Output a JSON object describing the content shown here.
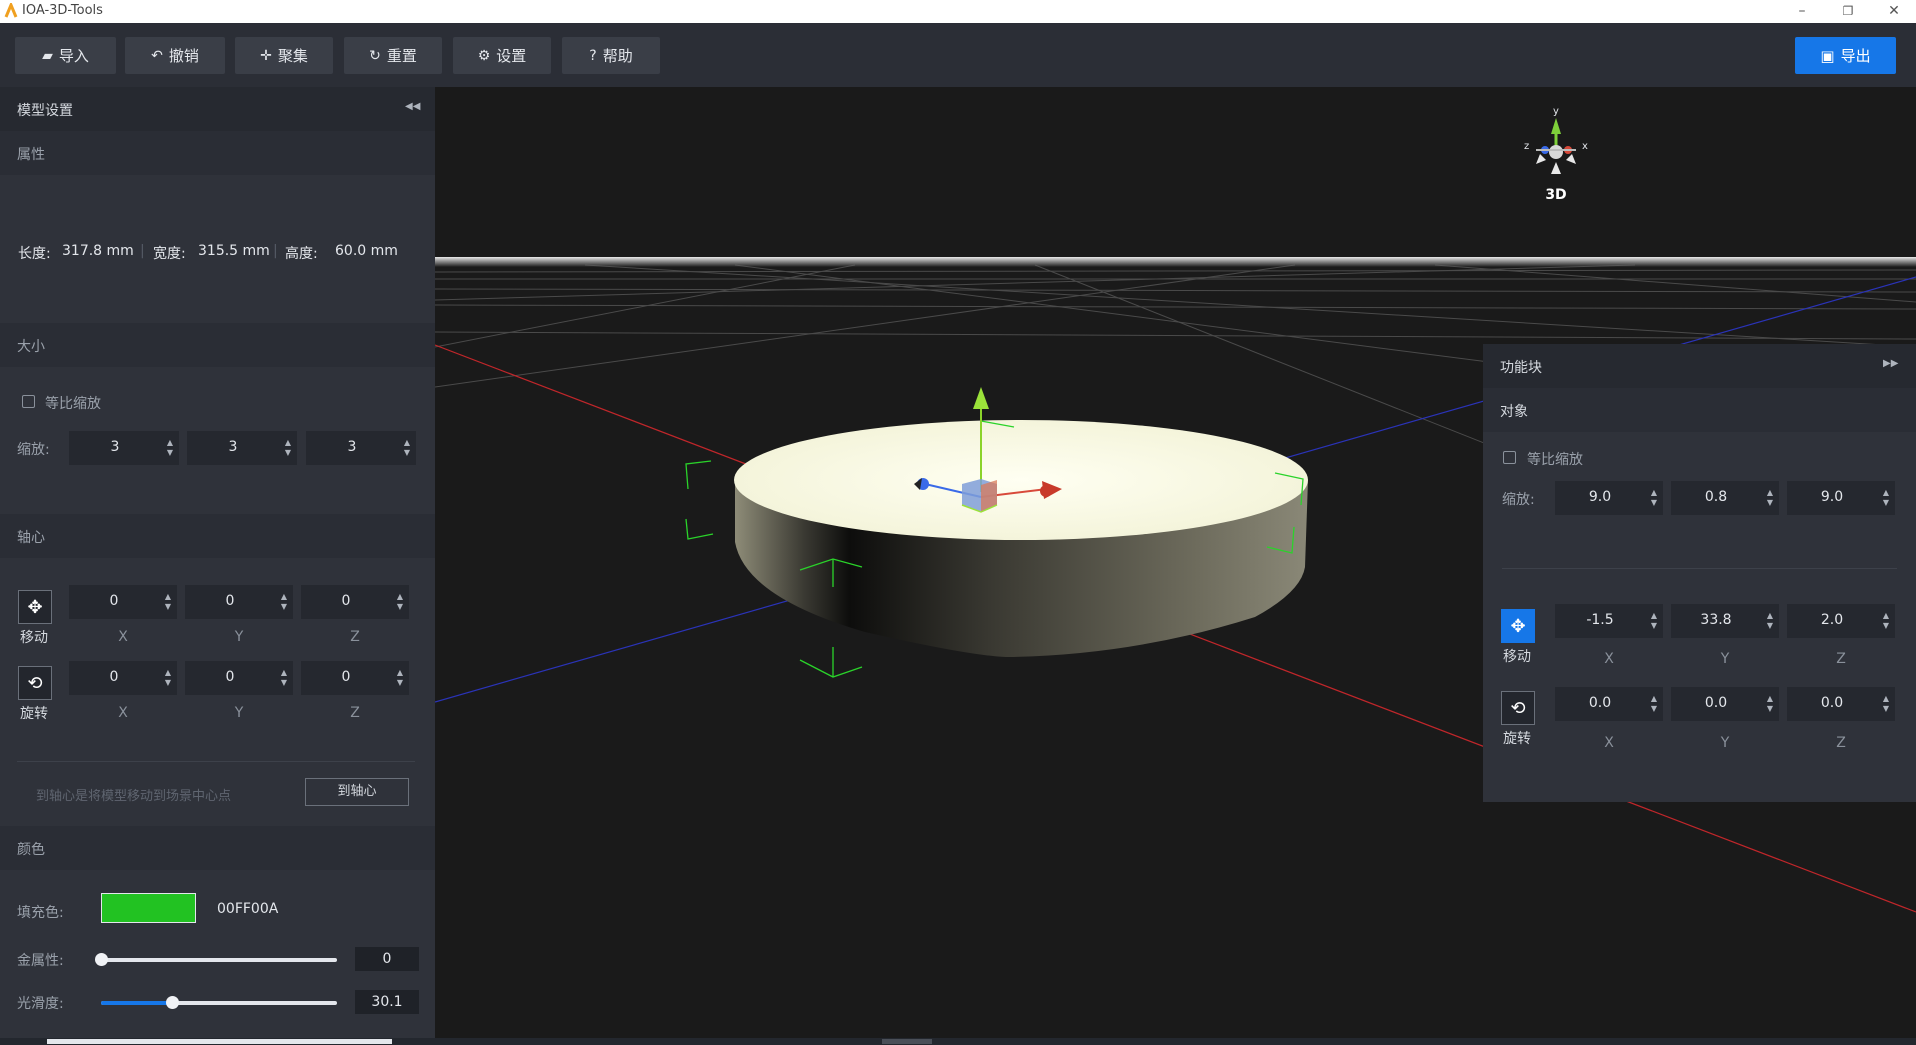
{
  "window": {
    "title": "IOA-3D-Tools",
    "minimize": "–",
    "restore": "❐",
    "close": "✕"
  },
  "toolbar": {
    "import": "导入",
    "undo": "撤销",
    "focus": "聚集",
    "reset": "重置",
    "settings": "设置",
    "help": "帮助",
    "export": "导出"
  },
  "left": {
    "title": "模型设置",
    "collapse_glyph": "◀◀",
    "attributes": {
      "header": "属性",
      "length_label": "长度:",
      "length_value": "317.8 mm",
      "width_label": "宽度:",
      "width_value": "315.5 mm",
      "height_label": "高度:",
      "height_value": "60.0 mm"
    },
    "size": {
      "header": "大小",
      "proportional_label": "等比缩放",
      "scale_label": "缩放:",
      "scale_values": [
        "3",
        "3",
        "3"
      ]
    },
    "pivot": {
      "header": "轴心",
      "move_label": "移动",
      "move_values": [
        "0",
        "0",
        "0"
      ],
      "rotate_label": "旋转",
      "rotate_values": [
        "0",
        "0",
        "0"
      ],
      "axes": [
        "X",
        "Y",
        "Z"
      ],
      "hint": "到轴心是将模型移动到场景中心点",
      "to_pivot_button": "到轴心"
    },
    "color": {
      "header": "颜色",
      "fill_label": "填充色:",
      "fill_hex": "00FF00A",
      "fill_color": "#22c222",
      "metal_label": "金属性:",
      "metal_value": "0",
      "metal_fraction": 0,
      "smooth_label": "光滑度:",
      "smooth_value": "30.1",
      "smooth_fraction": 0.301
    }
  },
  "viewport": {
    "gizmo_label": "3D",
    "axis_y": "y",
    "axis_x": "x",
    "axis_z": "z"
  },
  "right": {
    "title": "功能块",
    "expand_glyph": "▶▶",
    "object_header": "对象",
    "proportional_label": "等比缩放",
    "scale_label": "缩放:",
    "scale_values": [
      "9.0",
      "0.8",
      "9.0"
    ],
    "move_label": "移动",
    "move_values": [
      "-1.5",
      "33.8",
      "2.0"
    ],
    "rotate_label": "旋转",
    "rotate_values": [
      "0.0",
      "0.0",
      "0.0"
    ],
    "axes": [
      "X",
      "Y",
      "Z"
    ]
  }
}
